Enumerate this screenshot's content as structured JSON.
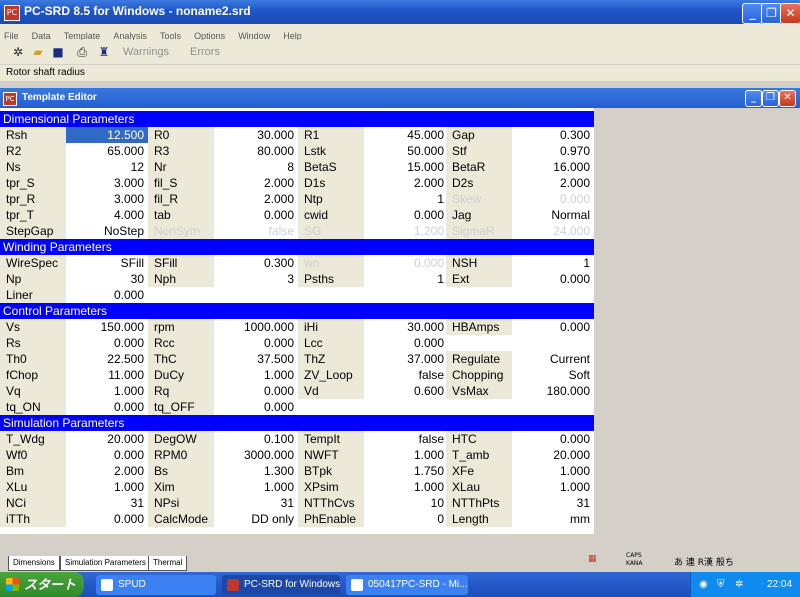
{
  "window": {
    "title": "PC-SRD 8.5 for Windows - noname2.srd",
    "icon": "PC"
  },
  "menu": [
    "File",
    "Data",
    "Template",
    "Analysis",
    "Tools",
    "Options",
    "Window",
    "Help"
  ],
  "toolbar": {
    "warnings": "Warnings",
    "errors": "Errors"
  },
  "status_text": "Rotor shaft radius",
  "editor": {
    "title": "Template Editor"
  },
  "sections": [
    {
      "title": "Dimensional Parameters",
      "rows": [
        [
          {
            "l": "Rsh",
            "v": "12.500",
            "sel": true
          },
          {
            "l": "R0",
            "v": "30.000"
          },
          {
            "l": "R1",
            "v": "45.000"
          },
          {
            "l": "Gap",
            "v": "0.300"
          }
        ],
        [
          {
            "l": "R2",
            "v": "65.000"
          },
          {
            "l": "R3",
            "v": "80.000"
          },
          {
            "l": "Lstk",
            "v": "50.000"
          },
          {
            "l": "Stf",
            "v": "0.970"
          }
        ],
        [
          {
            "l": "Ns",
            "v": "12"
          },
          {
            "l": "Nr",
            "v": "8"
          },
          {
            "l": "BetaS",
            "v": "15.000"
          },
          {
            "l": "BetaR",
            "v": "16.000"
          }
        ],
        [
          {
            "l": "tpr_S",
            "v": "3.000"
          },
          {
            "l": "fil_S",
            "v": "2.000"
          },
          {
            "l": "D1s",
            "v": "2.000"
          },
          {
            "l": "D2s",
            "v": "2.000"
          }
        ],
        [
          {
            "l": "tpr_R",
            "v": "3.000"
          },
          {
            "l": "fil_R",
            "v": "2.000"
          },
          {
            "l": "Ntp",
            "v": "1"
          },
          {
            "l": "Skew",
            "v": "0.000",
            "dis": true
          }
        ],
        [
          {
            "l": "tpr_T",
            "v": "4.000"
          },
          {
            "l": "tab",
            "v": "0.000"
          },
          {
            "l": "cwid",
            "v": "0.000"
          },
          {
            "l": "Jag",
            "v": "Normal"
          }
        ],
        [
          {
            "l": "StepGap",
            "v": "NoStep"
          },
          {
            "l": "NonSym",
            "v": "false",
            "dis": true
          },
          {
            "l": "SG",
            "v": "1.200",
            "dis": true
          },
          {
            "l": "SigmaR",
            "v": "24.000",
            "dis": true
          }
        ]
      ]
    },
    {
      "title": "Winding Parameters",
      "rows": [
        [
          {
            "l": "WireSpec",
            "v": "SFill"
          },
          {
            "l": "SFill",
            "v": "0.300"
          },
          {
            "l": "wn",
            "v": "0.000",
            "dis": true
          },
          {
            "l": "NSH",
            "v": "1"
          }
        ],
        [
          {
            "l": "Np",
            "v": "30"
          },
          {
            "l": "Nph",
            "v": "3"
          },
          {
            "l": "Psths",
            "v": "1"
          },
          {
            "l": "Ext",
            "v": "0.000"
          }
        ],
        [
          {
            "l": "Liner",
            "v": "0.000"
          }
        ]
      ]
    },
    {
      "title": "Control Parameters",
      "rows": [
        [
          {
            "l": "Vs",
            "v": "150.000"
          },
          {
            "l": "rpm",
            "v": "1000.000"
          },
          {
            "l": "iHi",
            "v": "30.000"
          },
          {
            "l": "HBAmps",
            "v": "0.000"
          }
        ],
        [
          {
            "l": "Rs",
            "v": "0.000"
          },
          {
            "l": "Rcc",
            "v": "0.000"
          },
          {
            "l": "Lcc",
            "v": "0.000"
          }
        ],
        [
          {
            "l": "Th0",
            "v": "22.500"
          },
          {
            "l": "ThC",
            "v": "37.500"
          },
          {
            "l": "ThZ",
            "v": "37.000"
          },
          {
            "l": "Regulate",
            "v": "Current"
          }
        ],
        [
          {
            "l": "fChop",
            "v": "11.000"
          },
          {
            "l": "DuCy",
            "v": "1.000"
          },
          {
            "l": "ZV_Loop",
            "v": "false"
          },
          {
            "l": "Chopping",
            "v": "Soft"
          }
        ],
        [
          {
            "l": "Vq",
            "v": "1.000"
          },
          {
            "l": "Rq",
            "v": "0.000"
          },
          {
            "l": "Vd",
            "v": "0.600"
          },
          {
            "l": "VsMax",
            "v": "180.000"
          }
        ],
        [
          {
            "l": "tq_ON",
            "v": "0.000"
          },
          {
            "l": "tq_OFF",
            "v": "0.000"
          }
        ]
      ]
    },
    {
      "title": "Simulation Parameters",
      "rows": [
        [
          {
            "l": "T_Wdg",
            "v": "20.000"
          },
          {
            "l": "DegOW",
            "v": "0.100"
          },
          {
            "l": "TempIt",
            "v": "false"
          },
          {
            "l": "HTC",
            "v": "0.000"
          }
        ],
        [
          {
            "l": "Wf0",
            "v": "0.000"
          },
          {
            "l": "RPM0",
            "v": "3000.000"
          },
          {
            "l": "NWFT",
            "v": "1.000"
          },
          {
            "l": "T_amb",
            "v": "20.000"
          }
        ],
        [
          {
            "l": "Bm",
            "v": "2.000"
          },
          {
            "l": "Bs",
            "v": "1.300"
          },
          {
            "l": "BTpk",
            "v": "1.750"
          },
          {
            "l": "XFe",
            "v": "1.000"
          }
        ],
        [
          {
            "l": "XLu",
            "v": "1.000"
          },
          {
            "l": "Xim",
            "v": "1.000"
          },
          {
            "l": "XPsim",
            "v": "1.000"
          },
          {
            "l": "XLau",
            "v": "1.000"
          }
        ],
        [
          {
            "l": "NCi",
            "v": "31"
          },
          {
            "l": "NPsi",
            "v": "31"
          },
          {
            "l": "NTThCvs",
            "v": "10"
          },
          {
            "l": "NTThPts",
            "v": "31"
          }
        ],
        [
          {
            "l": "iTTh",
            "v": "0.000"
          },
          {
            "l": "CalcMode",
            "v": "DD only"
          },
          {
            "l": "PhEnable",
            "v": "0"
          },
          {
            "l": "Length",
            "v": "mm"
          }
        ]
      ]
    }
  ],
  "tabs": [
    "Dimensions",
    "Simulation Parameters",
    "Thermal"
  ],
  "ime": {
    "line1": "CAPS",
    "line2": "KANA",
    "chars": "あ 連 R漢 般ち"
  },
  "taskbar": {
    "start": "スタート",
    "items": [
      {
        "label": "SPUD"
      },
      {
        "label": "PC-SRD for Windows"
      },
      {
        "label": "050417PC-SRD - Mi..."
      }
    ],
    "clock": "22:04"
  },
  "colors": {
    "section": "#0000ff",
    "selected": "#3169c6",
    "label_bg": "#ece9d8"
  }
}
